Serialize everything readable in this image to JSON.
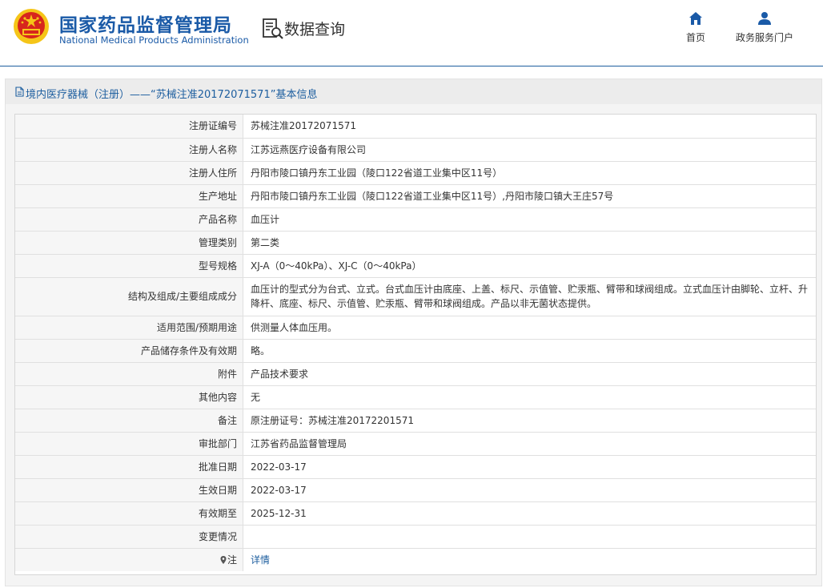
{
  "header": {
    "logo_cn": "国家药品监督管理局",
    "logo_en": "National Medical Products Administration",
    "query_title": "数据查询",
    "nav": {
      "home_label": "首页",
      "portal_label": "政务服务门户"
    }
  },
  "icons": {
    "emblem": "national-emblem-icon",
    "query": "search-document-icon",
    "home": "house-icon",
    "portal": "user-icon",
    "doc": "document-icon",
    "pin": "location-pin-icon"
  },
  "colors": {
    "brand_blue": "#1a5aa7",
    "link_blue": "#1d5e9f",
    "emblem_red": "#d7261d",
    "emblem_gold": "#f5c518"
  },
  "panel": {
    "title": "境内医疗器械（注册）——“苏械注准20172071571”基本信息"
  },
  "rows": [
    {
      "label": "注册证编号",
      "value": "苏械注准20172071571"
    },
    {
      "label": "注册人名称",
      "value": "江苏远燕医疗设备有限公司"
    },
    {
      "label": "注册人住所",
      "value": "丹阳市陵口镇丹东工业园（陵口122省道工业集中区11号）"
    },
    {
      "label": "生产地址",
      "value": "丹阳市陵口镇丹东工业园（陵口122省道工业集中区11号）,丹阳市陵口镇大王庄57号"
    },
    {
      "label": "产品名称",
      "value": "血压计"
    },
    {
      "label": "管理类别",
      "value": "第二类"
    },
    {
      "label": "型号规格",
      "value": "XJ-A（0～40kPa）、XJ-C（0～40kPa）"
    },
    {
      "label": "结构及组成/主要组成成分",
      "value": "血压计的型式分为台式、立式。台式血压计由底座、上盖、标尺、示值管、贮汞瓶、臂带和球阀组成。立式血压计由脚轮、立杆、升降杆、底座、标尺、示值管、贮汞瓶、臂带和球阀组成。产品以非无菌状态提供。"
    },
    {
      "label": "适用范围/预期用途",
      "value": "供测量人体血压用。"
    },
    {
      "label": "产品储存条件及有效期",
      "value": "略。"
    },
    {
      "label": "附件",
      "value": "产品技术要求"
    },
    {
      "label": "其他内容",
      "value": "无"
    },
    {
      "label": "备注",
      "value": "原注册证号：苏械注准20172201571"
    },
    {
      "label": "审批部门",
      "value": "江苏省药品监督管理局"
    },
    {
      "label": "批准日期",
      "value": "2022-03-17"
    },
    {
      "label": "生效日期",
      "value": "2022-03-17"
    },
    {
      "label": "有效期至",
      "value": "2025-12-31"
    },
    {
      "label": "变更情况",
      "value": ""
    },
    {
      "label": "注",
      "value": "详情"
    }
  ]
}
